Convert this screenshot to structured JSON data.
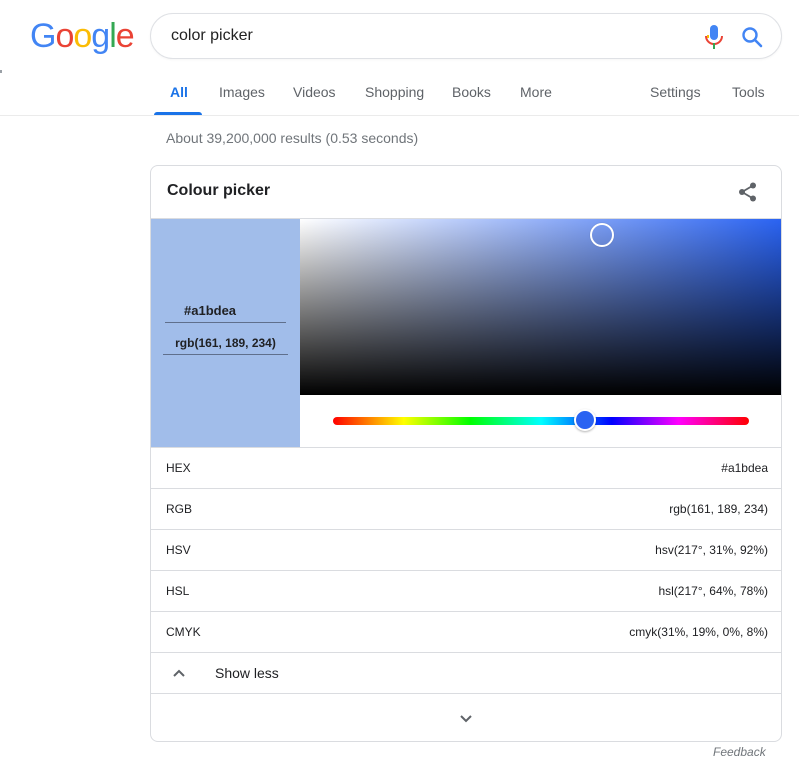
{
  "logo": {
    "letters": [
      {
        "char": "G",
        "color": "#4285F4"
      },
      {
        "char": "o",
        "color": "#EA4335"
      },
      {
        "char": "o",
        "color": "#FBBC05"
      },
      {
        "char": "g",
        "color": "#4285F4"
      },
      {
        "char": "l",
        "color": "#34A853"
      },
      {
        "char": "e",
        "color": "#EA4335"
      }
    ]
  },
  "search": {
    "query": "color picker",
    "mic_icon": "mic-icon",
    "search_icon": "search-icon"
  },
  "tabs": {
    "items": [
      "All",
      "Images",
      "Videos",
      "Shopping",
      "Books",
      "More"
    ],
    "right": [
      "Settings",
      "Tools"
    ],
    "active": "All",
    "accent": "#1a73e8"
  },
  "result_stats": "About 39,200,000 results (0.53 seconds)",
  "picker": {
    "title": "Colour picker",
    "share_icon": "share-icon",
    "hex": "#a1bdea",
    "rgb": "rgb(161, 189, 234)",
    "hue_fraction": 0.605,
    "saturation": 0.31,
    "value": 0.92,
    "rows": [
      {
        "label": "HEX",
        "value": "#a1bdea"
      },
      {
        "label": "RGB",
        "value": "rgb(161, 189, 234)"
      },
      {
        "label": "HSV",
        "value": "hsv(217°, 31%, 92%)"
      },
      {
        "label": "HSL",
        "value": "hsl(217°, 64%, 78%)"
      },
      {
        "label": "CMYK",
        "value": "cmyk(31%, 19%, 0%, 8%)"
      }
    ],
    "show_less": "Show less"
  },
  "feedback": "Feedback"
}
